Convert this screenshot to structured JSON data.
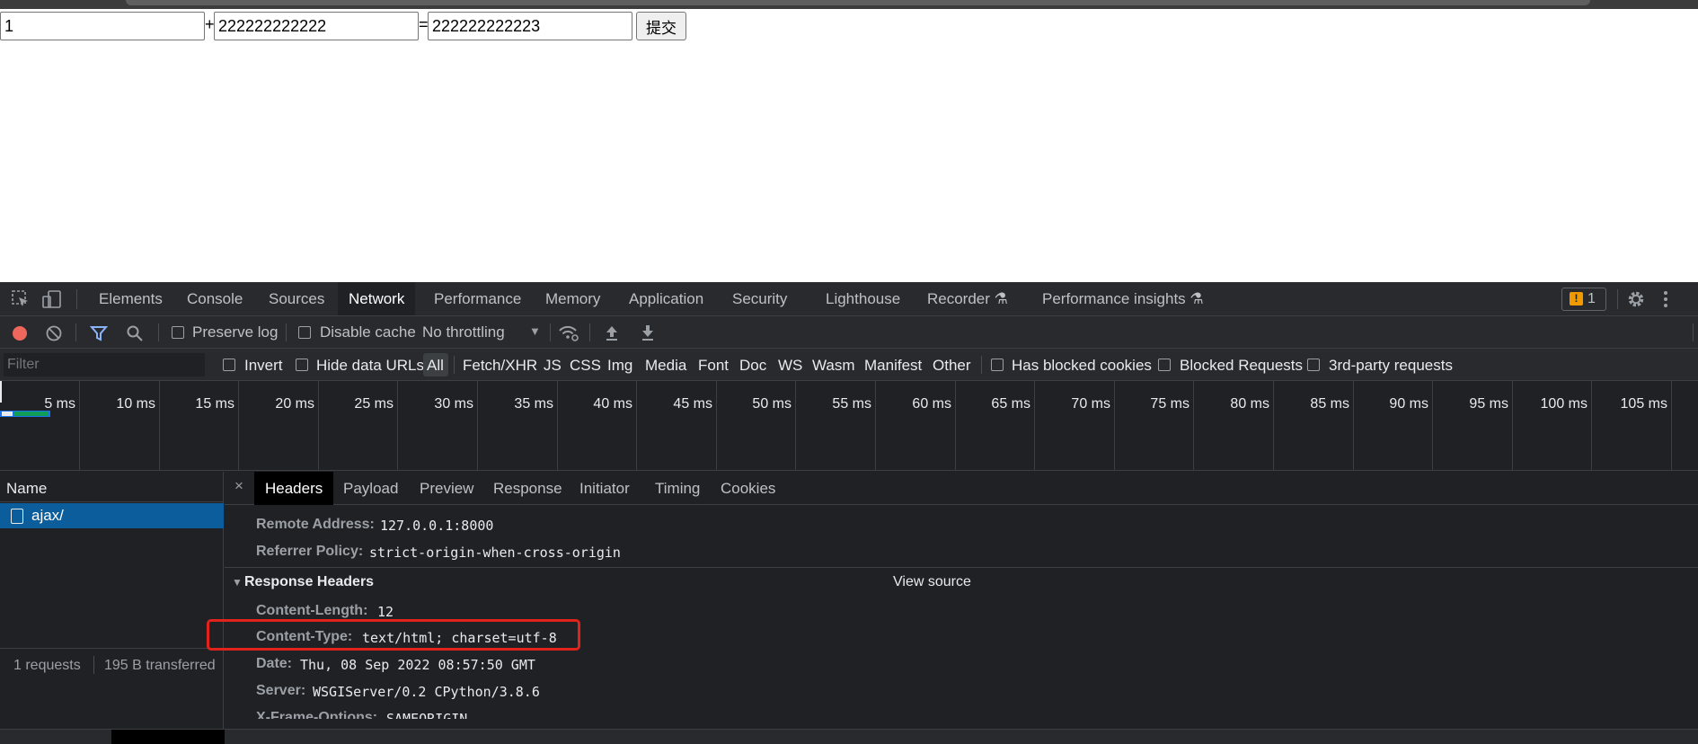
{
  "page": {
    "input1": "1",
    "plus": "+",
    "input2": "222222222222",
    "equals": "=",
    "result": "222222222223",
    "submit_label": "提交"
  },
  "devtools": {
    "tabs": [
      "Elements",
      "Console",
      "Sources",
      "Network",
      "Performance",
      "Memory",
      "Application",
      "Security",
      "Lighthouse",
      "Recorder",
      "Performance insights"
    ],
    "active_tab": "Network",
    "issues_count": "1",
    "toolbar": {
      "preserve_log": "Preserve log",
      "disable_cache": "Disable cache",
      "throttling": "No throttling"
    },
    "filter": {
      "placeholder": "Filter",
      "invert": "Invert",
      "hide_data_urls": "Hide data URLs",
      "types": [
        "All",
        "Fetch/XHR",
        "JS",
        "CSS",
        "Img",
        "Media",
        "Font",
        "Doc",
        "WS",
        "Wasm",
        "Manifest",
        "Other"
      ],
      "has_blocked_cookies": "Has blocked cookies",
      "blocked_requests": "Blocked Requests",
      "third_party": "3rd-party requests"
    },
    "timeline_ticks": [
      "5 ms",
      "10 ms",
      "15 ms",
      "20 ms",
      "25 ms",
      "30 ms",
      "35 ms",
      "40 ms",
      "45 ms",
      "50 ms",
      "55 ms",
      "60 ms",
      "65 ms",
      "70 ms",
      "75 ms",
      "80 ms",
      "85 ms",
      "90 ms",
      "95 ms",
      "100 ms",
      "105 ms"
    ],
    "list": {
      "header": "Name",
      "requests": [
        "ajax/"
      ],
      "summary_requests": "1 requests",
      "summary_transferred": "195 B transferred"
    },
    "detail_tabs": [
      "Headers",
      "Payload",
      "Preview",
      "Response",
      "Initiator",
      "Timing",
      "Cookies"
    ],
    "general": {
      "remote_address_key": "Remote Address:",
      "remote_address_val": "127.0.0.1:8000",
      "referrer_policy_key": "Referrer Policy:",
      "referrer_policy_val": "strict-origin-when-cross-origin"
    },
    "response_headers": {
      "title": "Response Headers",
      "view_source": "View source",
      "items": [
        {
          "key": "Content-Length:",
          "value": "12"
        },
        {
          "key": "Content-Type:",
          "value": "text/html; charset=utf-8"
        },
        {
          "key": "Date:",
          "value": "Thu, 08 Sep 2022 08:57:50 GMT"
        },
        {
          "key": "Server:",
          "value": "WSGIServer/0.2 CPython/3.8.6"
        },
        {
          "key": "X-Frame-Options:",
          "value": "SAMEORIGIN"
        }
      ]
    },
    "highlight_color": "#e0241b"
  }
}
